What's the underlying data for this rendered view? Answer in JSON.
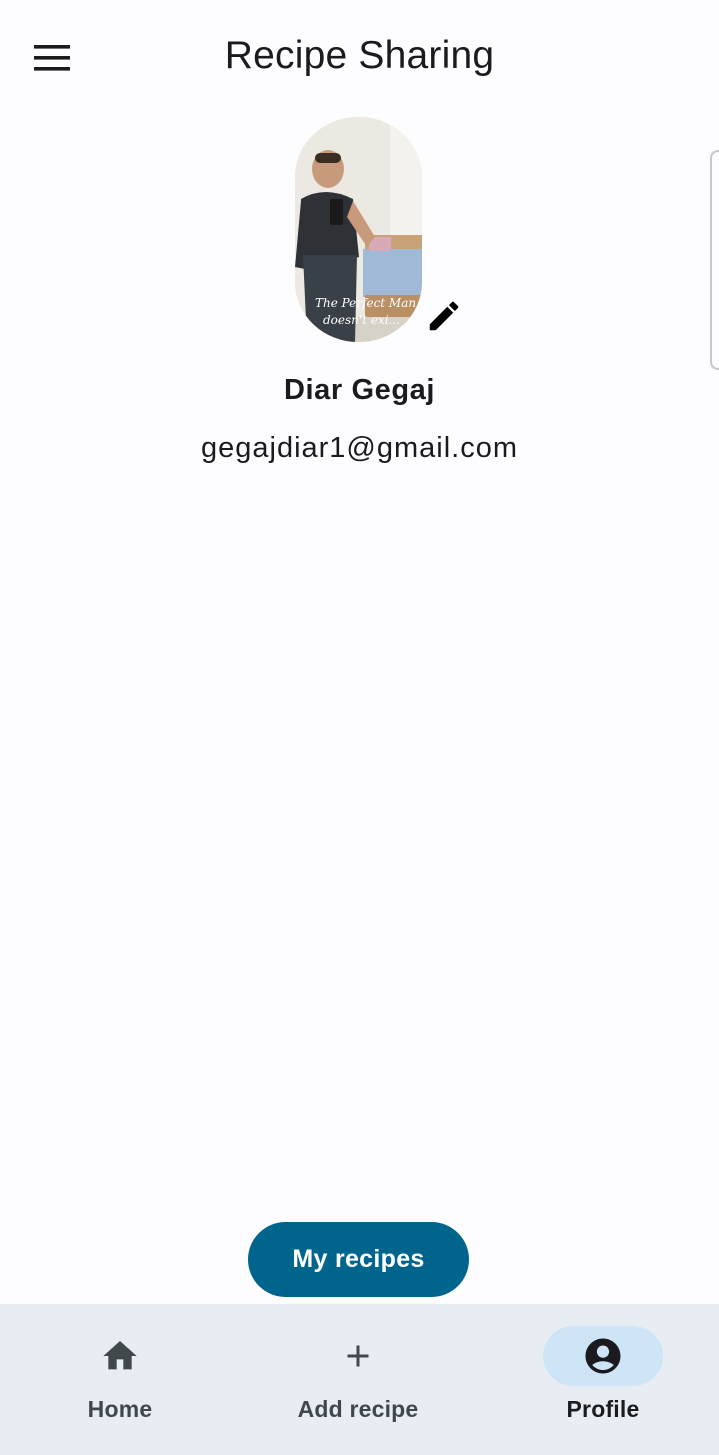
{
  "app_bar": {
    "title": "Recipe Sharing",
    "menu_icon": "hamburger-menu-icon"
  },
  "profile": {
    "name": "Diar Gegaj",
    "email": "gegajdiar1@gmail.com",
    "avatar_caption_line1": "The Perfect Man",
    "avatar_caption_line2": "doesn't exi...",
    "edit_icon": "pencil-icon"
  },
  "actions": {
    "my_recipes_label": "My recipes"
  },
  "bottom_nav": {
    "items": [
      {
        "label": "Home",
        "icon": "home-icon",
        "active": false
      },
      {
        "label": "Add recipe",
        "icon": "plus-icon",
        "active": false
      },
      {
        "label": "Profile",
        "icon": "account-circle-icon",
        "active": true
      }
    ]
  },
  "colors": {
    "primary": "#00658c",
    "nav_background": "#e7edf3",
    "nav_active_indicator": "#cde5f6",
    "background": "#fdfcff"
  }
}
